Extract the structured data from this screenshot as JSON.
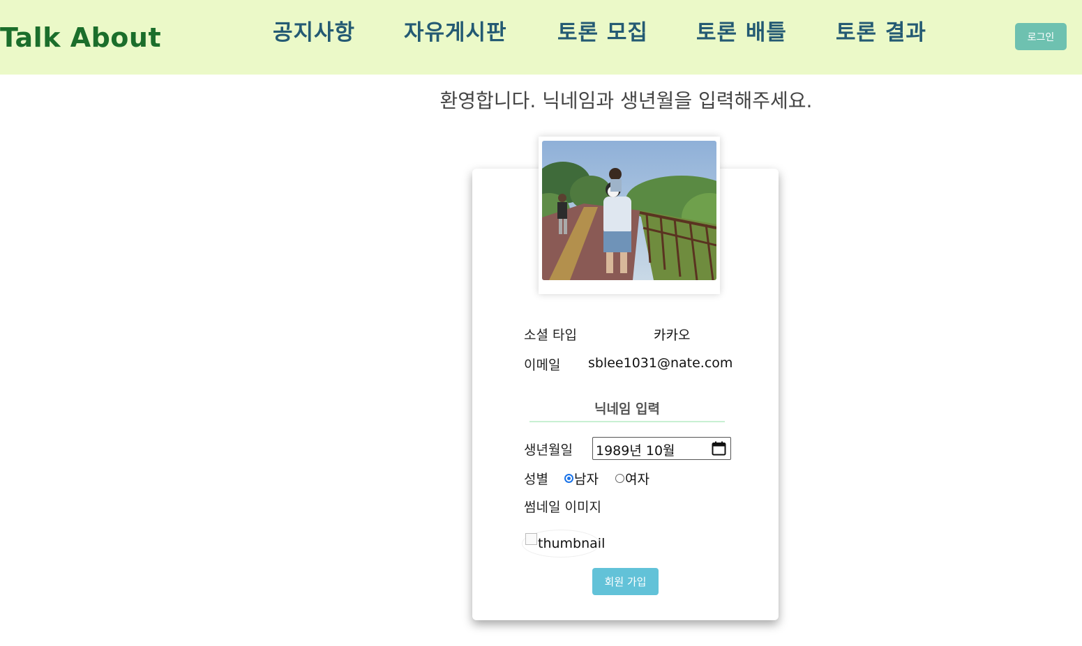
{
  "header": {
    "brand": "Talk About",
    "nav": [
      "공지사항",
      "자유게시판",
      "토론 모집",
      "토론 배틀",
      "토론 결과"
    ],
    "login_label": "로그인"
  },
  "welcome_text": "환영합니다. 닉네임과 생년월을 입력해주세요.",
  "form": {
    "social_type_label": "소셜 타입",
    "social_type_value": "카카오",
    "email_label": "이메일",
    "email_value": "sblee1031@nate.com",
    "nickname_placeholder": "닉네임 입력",
    "birth_label": "생년월일",
    "birth_value": "1989년 10월",
    "gender_label": "성별",
    "gender_options": [
      "남자",
      "여자"
    ],
    "gender_selected": "남자",
    "thumbnail_label": "썸네일 이미지",
    "thumbnail_alt": "thumbnail",
    "submit_label": "회원 가입"
  },
  "colors": {
    "header_bg": "#ebf9c8",
    "brand": "#1b6e2b",
    "nav": "#245a73",
    "login_btn": "#6ec1b0",
    "submit_btn": "#62c2d8",
    "radio_accent": "#1a73e8"
  },
  "icons": [
    "calendar-icon",
    "broken-image-icon"
  ]
}
